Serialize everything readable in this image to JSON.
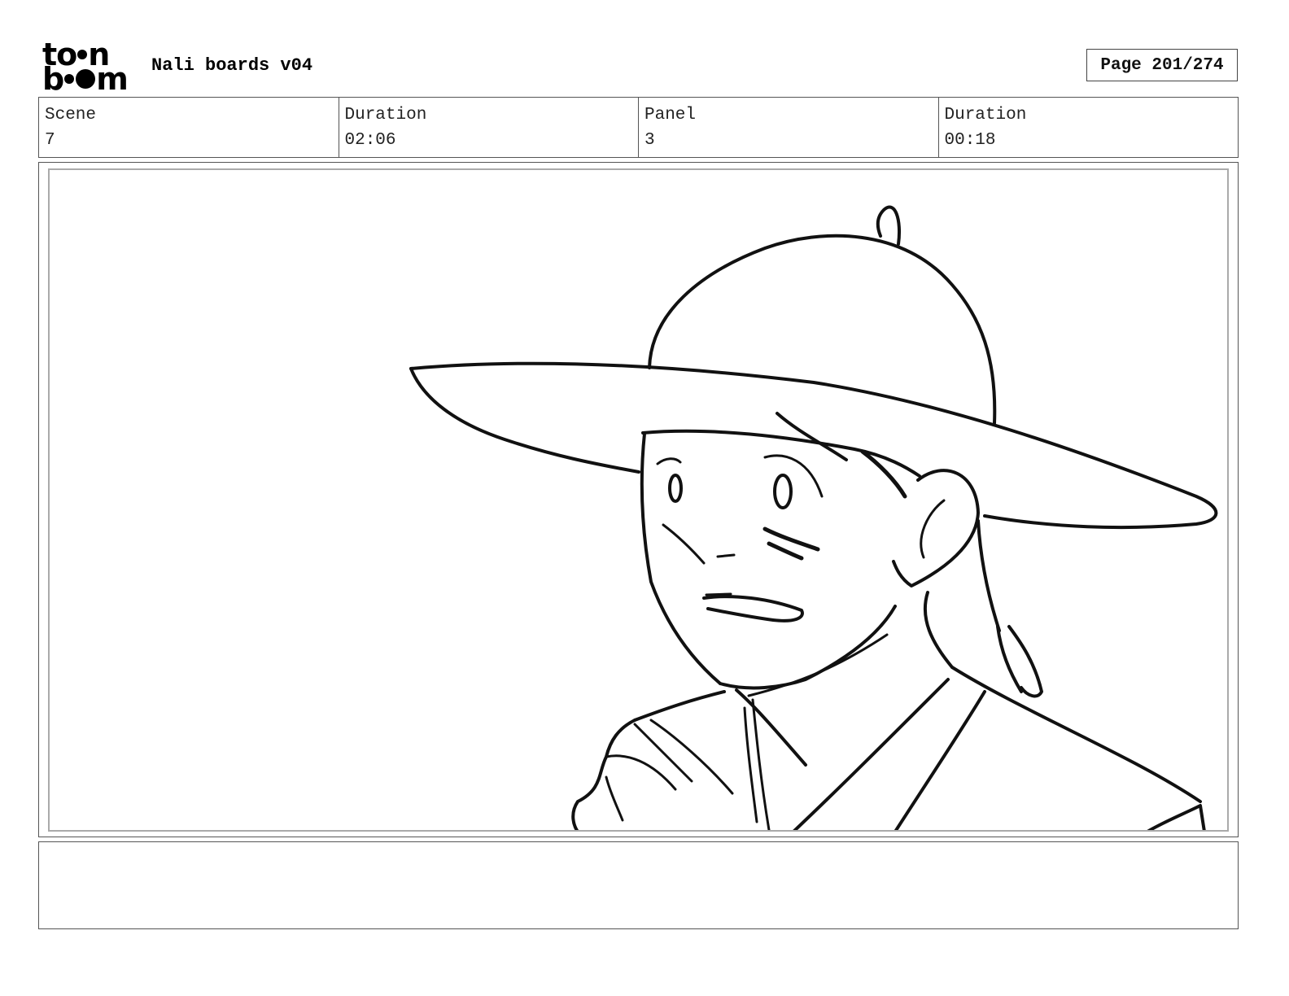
{
  "header": {
    "logo_top": "to",
    "logo_top_end": "n",
    "logo_bottom_start": "b",
    "logo_bottom_end": "m",
    "project_title": "Nali boards v04",
    "page_label": "Page 201/274"
  },
  "info": [
    {
      "label": "Scene",
      "value": "7"
    },
    {
      "label": "Duration",
      "value": "02:06"
    },
    {
      "label": "Panel",
      "value": "3"
    },
    {
      "label": "Duration",
      "value": "00:18"
    }
  ],
  "notes": {
    "text": ""
  }
}
